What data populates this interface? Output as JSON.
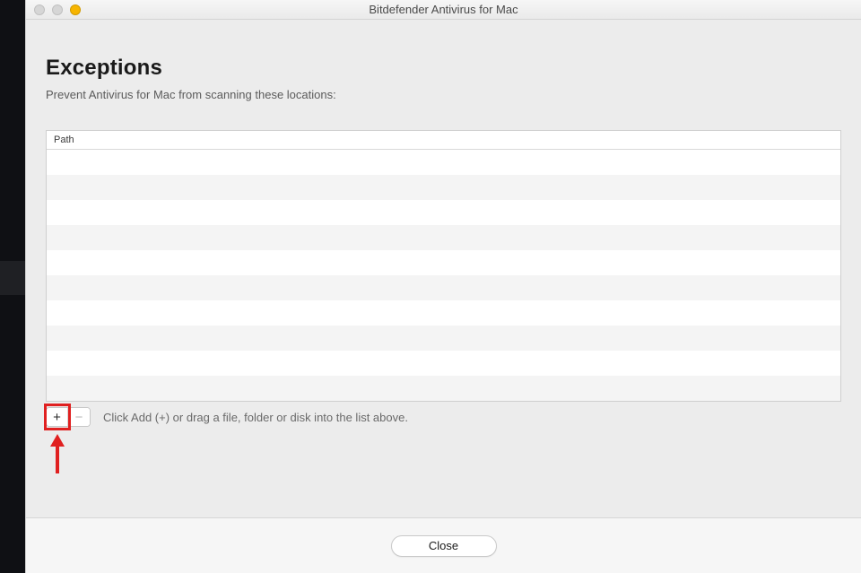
{
  "window": {
    "title": "Bitdefender Antivirus for Mac"
  },
  "header": {
    "title": "Exceptions",
    "subtitle": "Prevent Antivirus for Mac from scanning these locations:"
  },
  "table": {
    "column_header": "Path",
    "rows": [
      "",
      "",
      "",
      "",
      "",
      "",
      "",
      "",
      "",
      ""
    ]
  },
  "controls": {
    "add_label": "+",
    "remove_label": "−",
    "hint": "Click Add (+) or drag a file, folder or disk into the list above."
  },
  "footer": {
    "close_label": "Close"
  },
  "annotation": {
    "color": "#e02020"
  }
}
